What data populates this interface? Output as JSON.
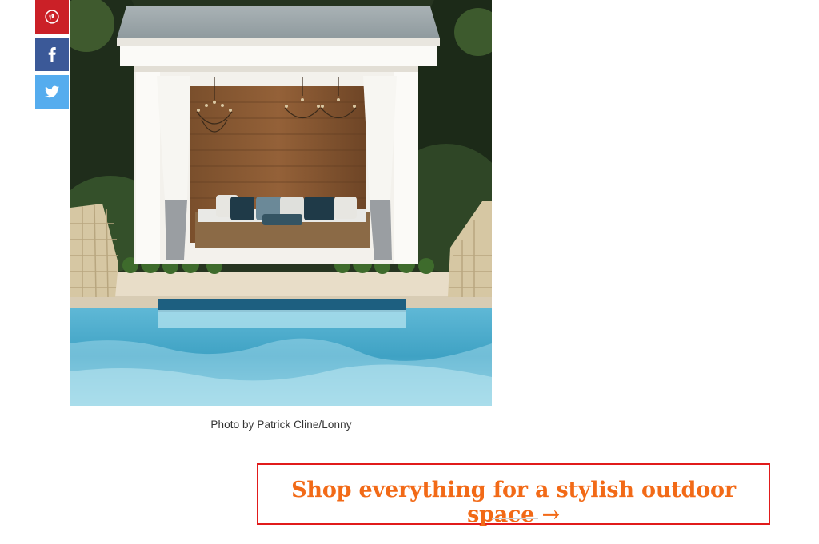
{
  "share": {
    "items": [
      {
        "network": "pinterest",
        "icon": "pinterest-icon",
        "color": "#cb2027"
      },
      {
        "network": "facebook",
        "icon": "facebook-icon",
        "color": "#3b5998"
      },
      {
        "network": "twitter",
        "icon": "twitter-icon",
        "color": "#55acee"
      }
    ]
  },
  "article": {
    "photo_alt": "Poolside cabana with white curtains, chandeliers, and a daybed",
    "caption": "Photo by Patrick Cline/Lonny",
    "shop_link_text": "Shop everything for a stylish outdoor space",
    "shop_link_arrow": "→",
    "accent_color": "#f26a17",
    "highlight_border_color": "#e11b1b"
  }
}
